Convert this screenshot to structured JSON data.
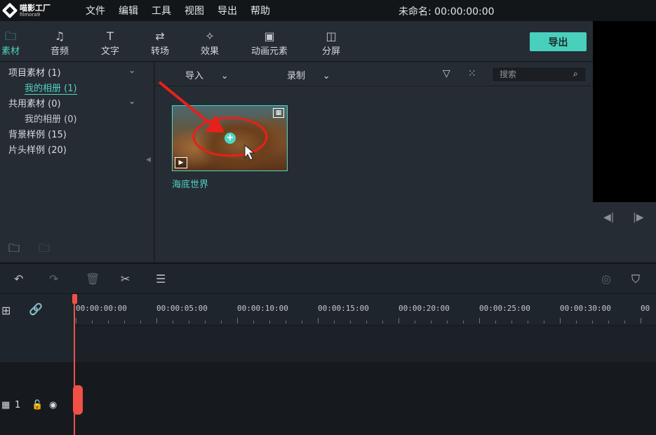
{
  "app": {
    "logo_name": "喵影工厂",
    "logo_sub": "filmora9",
    "menu": [
      "文件",
      "编辑",
      "工具",
      "视图",
      "导出",
      "帮助"
    ],
    "project_title": "未命名: 00:00:00:00"
  },
  "tabs": [
    {
      "label": "素材",
      "icon": "folder-icon",
      "active": true
    },
    {
      "label": "音频",
      "icon": "music-note-icon",
      "active": false
    },
    {
      "label": "文字",
      "icon": "text-icon",
      "active": false
    },
    {
      "label": "转场",
      "icon": "transition-icon",
      "active": false
    },
    {
      "label": "效果",
      "icon": "effects-icon",
      "active": false
    },
    {
      "label": "动画元素",
      "icon": "image-icon",
      "active": false
    },
    {
      "label": "分屏",
      "icon": "split-screen-icon",
      "active": false
    }
  ],
  "export_label": "导出",
  "sidebar": {
    "items": [
      {
        "label": "项目素材 (1)"
      },
      {
        "label": "我的相册 (1)"
      },
      {
        "label": "共用素材 (0)"
      },
      {
        "label": "我的相册 (0)"
      },
      {
        "label": "背景样例 (15)"
      },
      {
        "label": "片头样例 (20)"
      }
    ]
  },
  "media_toolbar": {
    "import_label": "导入",
    "record_label": "录制",
    "search_placeholder": "搜索"
  },
  "media": {
    "clip_label": "海底世界"
  },
  "timeline": {
    "ticks": [
      "00:00:00:00",
      "00:00:05:00",
      "00:00:10:00",
      "00:00:15:00",
      "00:00:20:00",
      "00:00:25:00",
      "00:00:30:00"
    ],
    "track_number": "1"
  },
  "colors": {
    "accent": "#4fd5c6",
    "playhead": "#f25045",
    "annotation": "#e8201a"
  }
}
